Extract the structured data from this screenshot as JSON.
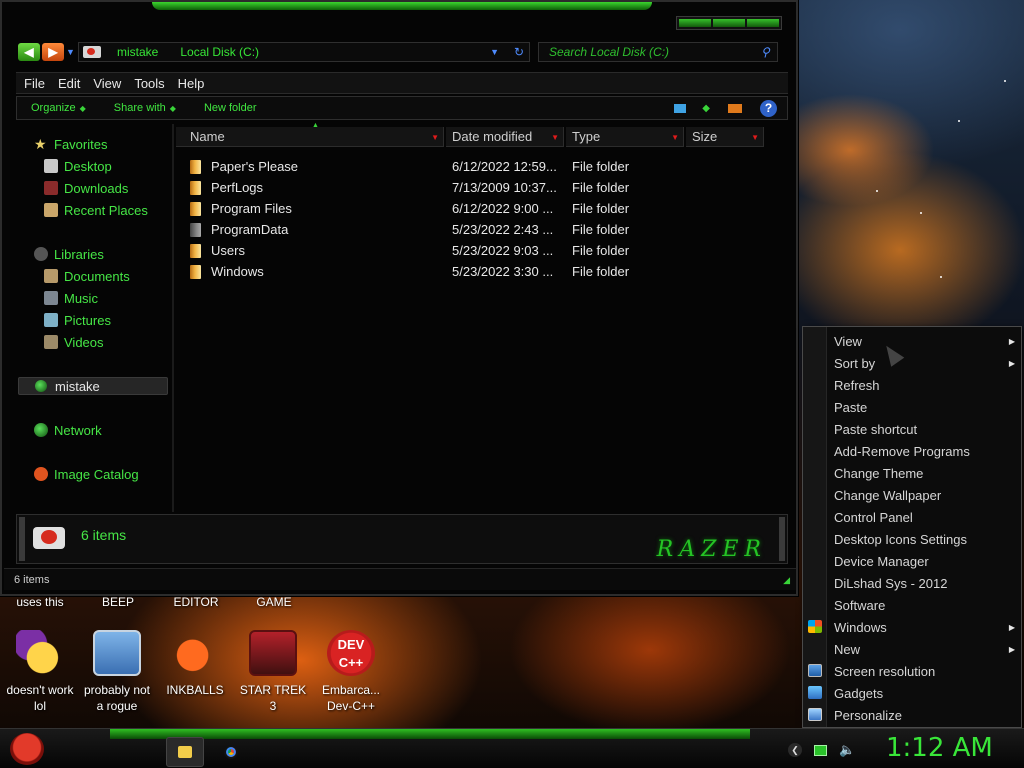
{
  "explorer": {
    "address": {
      "crumbs": [
        "mistake",
        "Local Disk (C:)"
      ]
    },
    "search_placeholder": "Search Local Disk (C:)",
    "menu": [
      "File",
      "Edit",
      "View",
      "Tools",
      "Help"
    ],
    "commands": {
      "organize": "Organize",
      "share_with": "Share with",
      "new_folder": "New folder"
    },
    "nav": {
      "favorites": "Favorites",
      "desktop": "Desktop",
      "downloads": "Downloads",
      "recent": "Recent Places",
      "libraries": "Libraries",
      "documents": "Documents",
      "music": "Music",
      "pictures": "Pictures",
      "videos": "Videos",
      "computer": "mistake",
      "network": "Network",
      "image_catalog": "Image Catalog"
    },
    "columns": {
      "name": "Name",
      "date": "Date modified",
      "type": "Type",
      "size": "Size"
    },
    "files": [
      {
        "name": "Paper's Please",
        "date": "6/12/2022 12:59...",
        "type": "File folder"
      },
      {
        "name": "PerfLogs",
        "date": "7/13/2009 10:37...",
        "type": "File folder"
      },
      {
        "name": "Program Files",
        "date": "6/12/2022 9:00 ...",
        "type": "File folder"
      },
      {
        "name": "ProgramData",
        "date": "5/23/2022 2:43 ...",
        "type": "File folder"
      },
      {
        "name": "Users",
        "date": "5/23/2022 9:03 ...",
        "type": "File folder"
      },
      {
        "name": "Windows",
        "date": "5/23/2022 3:30 ...",
        "type": "File folder"
      }
    ],
    "details_count": "6 items",
    "status": "6 items",
    "logo_text": "RAZER"
  },
  "desktop": {
    "partial_labels": [
      "uses this",
      "BEEP",
      "EDITOR",
      "GAME"
    ],
    "icons": [
      {
        "label1": "doesn't work",
        "label2": "lol"
      },
      {
        "label1": "probably not",
        "label2": "a rogue"
      },
      {
        "label1": "INKBALLS",
        "label2": ""
      },
      {
        "label1": "STAR TREK",
        "label2": "3"
      },
      {
        "label1": "Embarca...",
        "label2": "Dev-C++"
      }
    ],
    "dev_icon_text": "DEV C++"
  },
  "context_menu": [
    {
      "label": "View",
      "submenu": true
    },
    {
      "label": "Sort by",
      "submenu": true
    },
    {
      "label": "Refresh"
    },
    {
      "label": "Paste"
    },
    {
      "label": "Paste shortcut"
    },
    {
      "label": "Add-Remove Programs"
    },
    {
      "label": "Change Theme"
    },
    {
      "label": "Change Wallpaper"
    },
    {
      "label": "Control Panel"
    },
    {
      "label": "Desktop Icons Settings"
    },
    {
      "label": "Device Manager"
    },
    {
      "label": "DiLshad Sys - 2012"
    },
    {
      "label": "Software"
    },
    {
      "label": "Windows",
      "submenu": true,
      "icon": "windows-logo-icon"
    },
    {
      "label": "New",
      "submenu": true
    },
    {
      "label": "Screen resolution",
      "icon": "screen-resolution-icon"
    },
    {
      "label": "Gadgets",
      "icon": "gadgets-icon"
    },
    {
      "label": "Personalize",
      "icon": "personalize-icon"
    }
  ],
  "taskbar": {
    "clock": "1:12 AM"
  },
  "colors": {
    "accent_green": "#39e639",
    "sort_red": "#e01b1b"
  }
}
